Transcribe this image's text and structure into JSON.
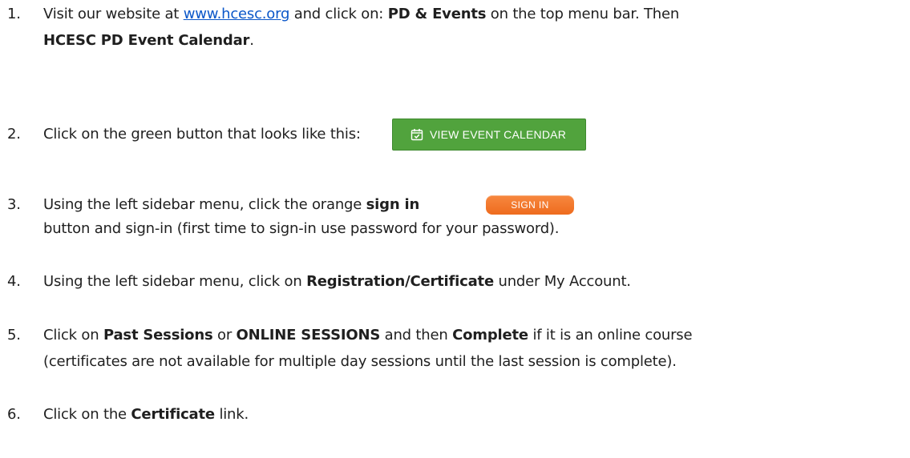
{
  "steps": [
    {
      "num": "1.",
      "lines": [
        {
          "a": "Visit our website at ",
          "link": "www.hcesc.org",
          "b": " and click on:  ",
          "bold1": "PD & Events",
          "c": " on the top menu bar.  Then"
        },
        {
          "bold": "HCESC PD Event Calendar",
          "after": "."
        }
      ]
    },
    {
      "num": "2.",
      "text": "Click on the green button that looks like this:",
      "button_label": "VIEW EVENT CALENDAR",
      "button_icon": "calendar-check-icon",
      "button_color": "#51a33d"
    },
    {
      "num": "3.",
      "text_before": "Using the left sidebar menu, click the orange ",
      "bold": "sign in",
      "button_label": "SIGN IN",
      "button_color": "#f07a2e",
      "line2": "button and sign-in (first time to sign-in use password for your password)."
    },
    {
      "num": "4.",
      "text_before": "Using the left sidebar menu, click on ",
      "bold": "Registration/Certificate",
      "text_after": " under My Account."
    },
    {
      "num": "5.",
      "a": "Click on ",
      "bold1": "Past Sessions",
      "b": " or ",
      "bold2": "ONLINE SESSIONS",
      "c": " and then ",
      "bold3": "Complete",
      "d": " if it is an online course",
      "line2": "(certificates are not available for multiple day sessions until the last session is complete)."
    },
    {
      "num": "6.",
      "a": "Click on the ",
      "bold": "Certificate",
      "b": " link."
    }
  ]
}
